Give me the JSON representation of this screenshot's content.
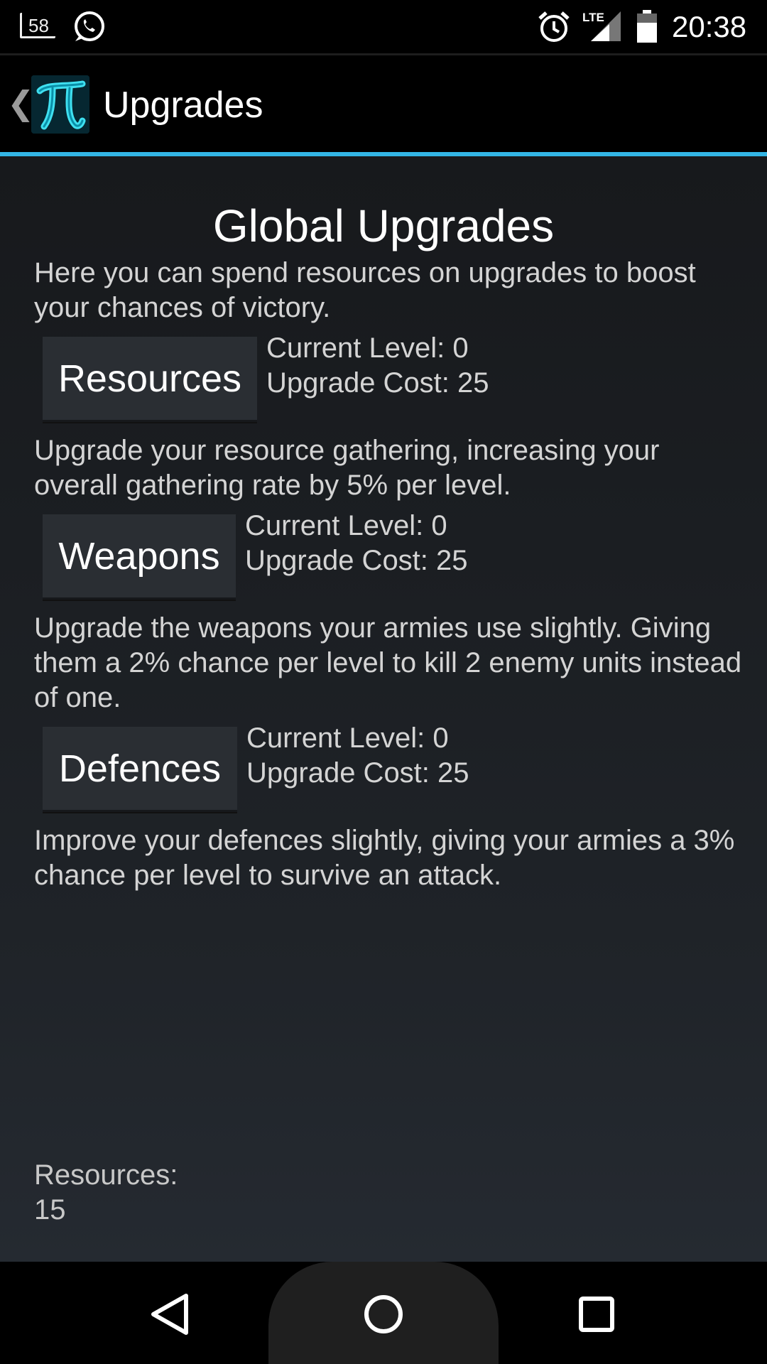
{
  "status_bar": {
    "notification_count": "58",
    "network": "LTE",
    "time": "20:38"
  },
  "action_bar": {
    "back_glyph": "❮",
    "title": "Upgrades",
    "logo_glyph": "π",
    "accent_color": "#33b5e5"
  },
  "main": {
    "heading": "Global Upgrades",
    "intro": "Here you can spend resources on upgrades to boost your chances of victory.",
    "upgrades": [
      {
        "button": "Resources",
        "level": "Current Level: 0",
        "cost": "Upgrade Cost: 25",
        "description": "Upgrade your resource gathering, increasing your overall gathering rate by 5% per level."
      },
      {
        "button": "Weapons",
        "level": "Current Level: 0",
        "cost": "Upgrade Cost: 25",
        "description": "Upgrade the weapons your armies use slightly. Giving them a 2% chance per level to kill 2 enemy units instead of one."
      },
      {
        "button": "Defences",
        "level": "Current Level: 0",
        "cost": "Upgrade Cost: 25",
        "description": "Improve your defences slightly, giving your armies a 3% chance per level to survive an attack."
      }
    ],
    "resources_label": "Resources:",
    "resources_value": "15"
  },
  "nav_bar": {
    "icons": [
      "back-icon",
      "home-icon",
      "recents-icon"
    ]
  }
}
